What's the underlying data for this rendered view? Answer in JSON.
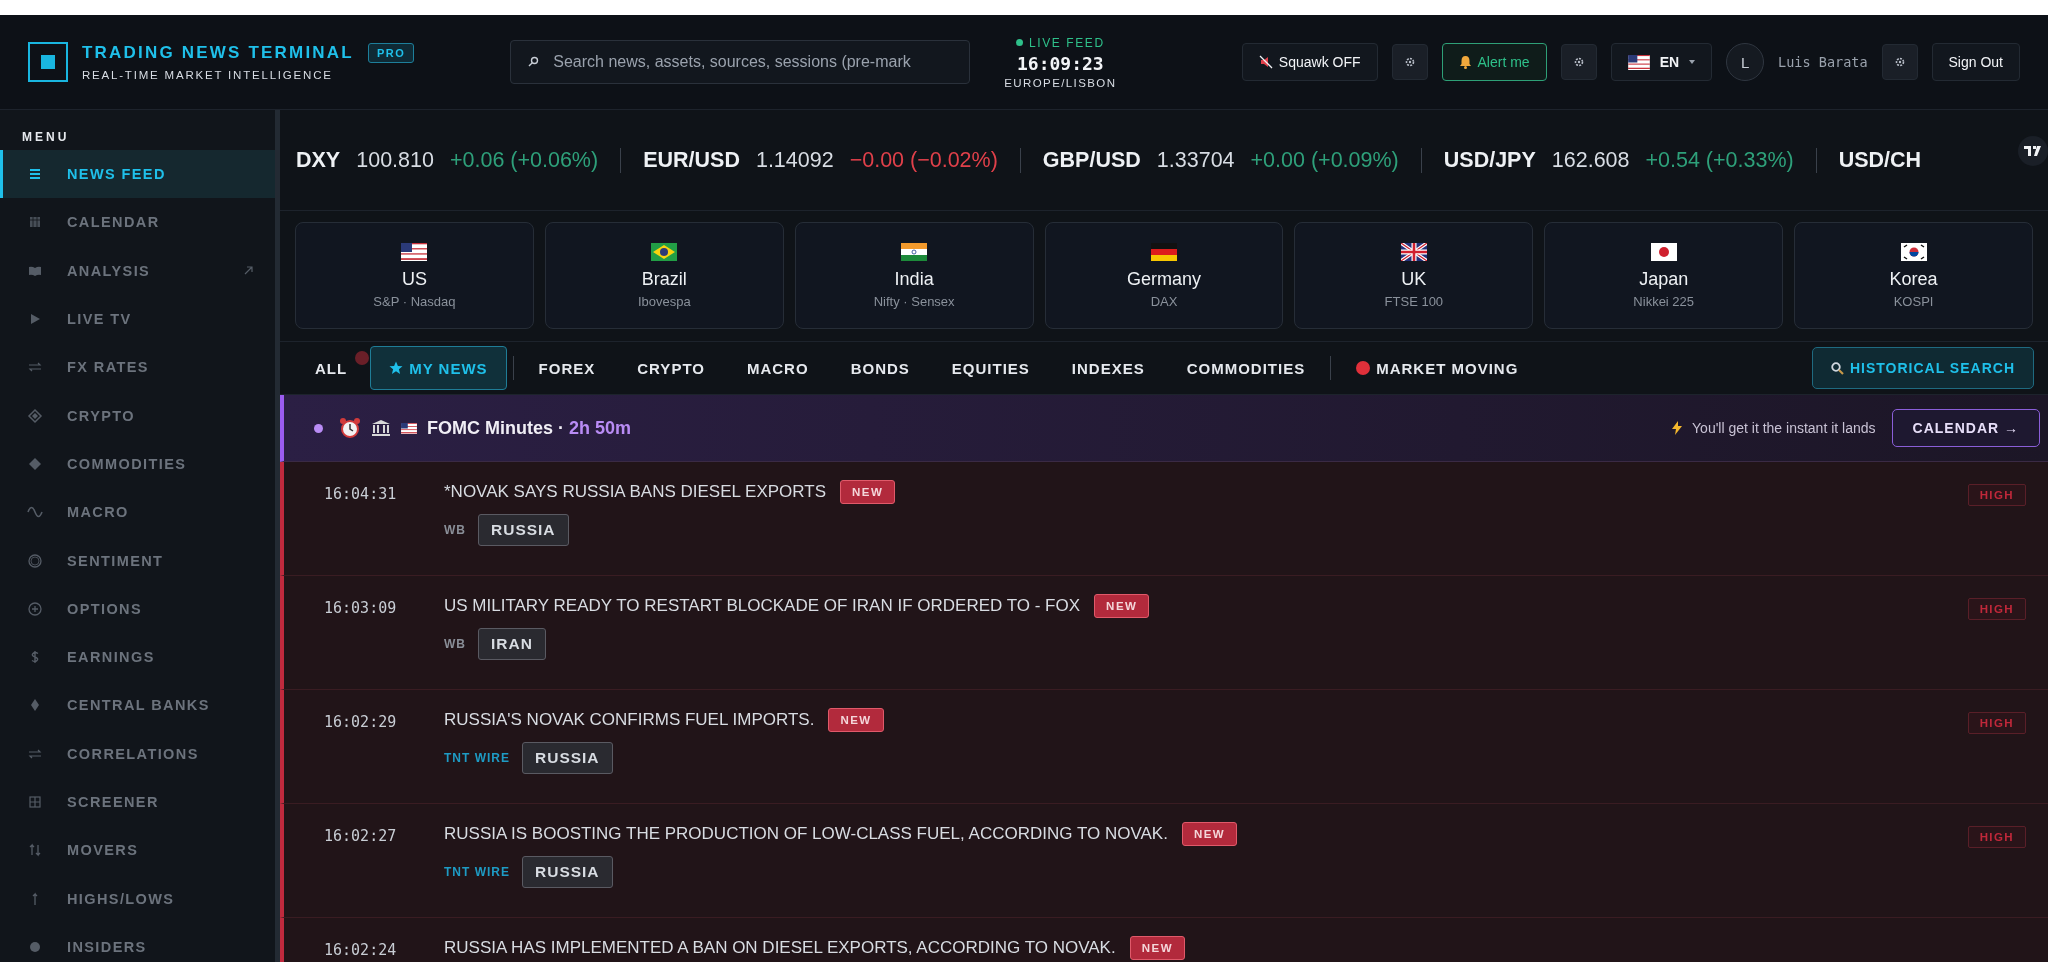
{
  "header": {
    "title": "TRADING NEWS TERMINAL",
    "badge": "PRO",
    "subtitle": "REAL-TIME MARKET INTELLIGENCE",
    "search": {
      "placeholder": "Search news, assets, sources, sessions (pre-mark"
    },
    "live": {
      "label": "LIVE FEED",
      "time": "16:09:23",
      "timezone": "EUROPE/LISBON"
    },
    "squawk": "Squawk OFF",
    "alert": "Alert me",
    "language": "EN",
    "avatar": "L",
    "user": "Luis Barata",
    "sign_out": "Sign Out"
  },
  "sidebar": {
    "heading": "MENU",
    "items": [
      {
        "label": "NEWS FEED",
        "selected": true
      },
      {
        "label": "CALENDAR",
        "selected": false
      },
      {
        "label": "ANALYSIS",
        "selected": false,
        "external": true
      },
      {
        "label": "LIVE TV",
        "selected": false
      },
      {
        "label": "FX RATES",
        "selected": false
      },
      {
        "label": "CRYPTO",
        "selected": false
      },
      {
        "label": "COMMODITIES",
        "selected": false
      },
      {
        "label": "MACRO",
        "selected": false
      },
      {
        "label": "SENTIMENT",
        "selected": false
      },
      {
        "label": "OPTIONS",
        "selected": false
      },
      {
        "label": "EARNINGS",
        "selected": false
      },
      {
        "label": "CENTRAL BANKS",
        "selected": false
      },
      {
        "label": "CORRELATIONS",
        "selected": false
      },
      {
        "label": "SCREENER",
        "selected": false
      },
      {
        "label": "MOVERS",
        "selected": false
      },
      {
        "label": "HIGHS/LOWS",
        "selected": false
      },
      {
        "label": "INSIDERS",
        "selected": false
      }
    ]
  },
  "ticker": [
    {
      "symbol": "DXY",
      "price": "100.810",
      "change": "+0.06 (+0.06%)",
      "color": "#2ea07a"
    },
    {
      "symbol": "EUR/USD",
      "price": "1.14092",
      "change": "−0.00 (−0.02%)",
      "color": "#e0404a"
    },
    {
      "symbol": "GBP/USD",
      "price": "1.33704",
      "change": "+0.00 (+0.09%)",
      "color": "#2ea07a"
    },
    {
      "symbol": "USD/JPY",
      "price": "162.608",
      "change": "+0.54 (+0.33%)",
      "color": "#2ea07a"
    },
    {
      "symbol": "USD/CH"
    }
  ],
  "markets": [
    {
      "country": "US",
      "indices": "S&P · Nasdaq",
      "kind": "us"
    },
    {
      "country": "Brazil",
      "indices": "Ibovespa",
      "kind": "br"
    },
    {
      "country": "India",
      "indices": "Nifty · Sensex",
      "kind": "in"
    },
    {
      "country": "Germany",
      "indices": "DAX",
      "kind": "de"
    },
    {
      "country": "UK",
      "indices": "FTSE 100",
      "kind": "gb"
    },
    {
      "country": "Japan",
      "indices": "Nikkei 225",
      "kind": "jp"
    },
    {
      "country": "Korea",
      "indices": "KOSPI",
      "kind": "kr"
    }
  ],
  "tabs": [
    {
      "label": "ALL",
      "selected": false,
      "kind": "plain"
    },
    {
      "label": "MY NEWS",
      "selected": true,
      "kind": "star"
    },
    {
      "label": "FOREX",
      "selected": false,
      "kind": "plain"
    },
    {
      "label": "CRYPTO",
      "selected": false,
      "kind": "plain"
    },
    {
      "label": "MACRO",
      "selected": false,
      "kind": "plain"
    },
    {
      "label": "BONDS",
      "selected": false,
      "kind": "plain"
    },
    {
      "label": "EQUITIES",
      "selected": false,
      "kind": "plain"
    },
    {
      "label": "INDEXES",
      "selected": false,
      "kind": "plain"
    },
    {
      "label": "COMMODITIES",
      "selected": false,
      "kind": "plain"
    },
    {
      "label": "MARKET MOVING",
      "selected": false,
      "kind": "alert"
    }
  ],
  "historical_search": "HISTORICAL SEARCH",
  "event_banner": {
    "title": "FOMC Minutes · ",
    "countdown": "2h 50m",
    "note": "You'll get it the instant it lands",
    "button": "CALENDAR →"
  },
  "news": [
    {
      "time": "16:04:31",
      "headline": "*NOVAK SAYS RUSSIA BANS DIESEL EXPORTS",
      "badge": "NEW",
      "source": "WB",
      "color": "#8a8f98",
      "tag": "RUSSIA",
      "impact": "HIGH"
    },
    {
      "time": "16:03:09",
      "headline": "US MILITARY READY TO RESTART BLOCKADE OF IRAN IF ORDERED TO - FOX",
      "badge": "NEW",
      "source": "WB",
      "color": "#8a8f98",
      "tag": "IRAN",
      "impact": "HIGH"
    },
    {
      "time": "16:02:29",
      "headline": "RUSSIA'S NOVAK CONFIRMS FUEL IMPORTS.",
      "badge": "NEW",
      "source": "TNT WIRE",
      "color": "#1e9bc4",
      "tag": "RUSSIA",
      "impact": "HIGH"
    },
    {
      "time": "16:02:27",
      "headline": "RUSSIA IS BOOSTING THE PRODUCTION OF LOW-CLASS FUEL, ACCORDING TO NOVAK.",
      "badge": "NEW",
      "source": "TNT WIRE",
      "color": "#1e9bc4",
      "tag": "RUSSIA",
      "impact": "HIGH"
    },
    {
      "time": "16:02:24",
      "headline": "RUSSIA HAS IMPLEMENTED A BAN ON DIESEL EXPORTS, ACCORDING TO NOVAK.",
      "badge": "NEW"
    }
  ]
}
